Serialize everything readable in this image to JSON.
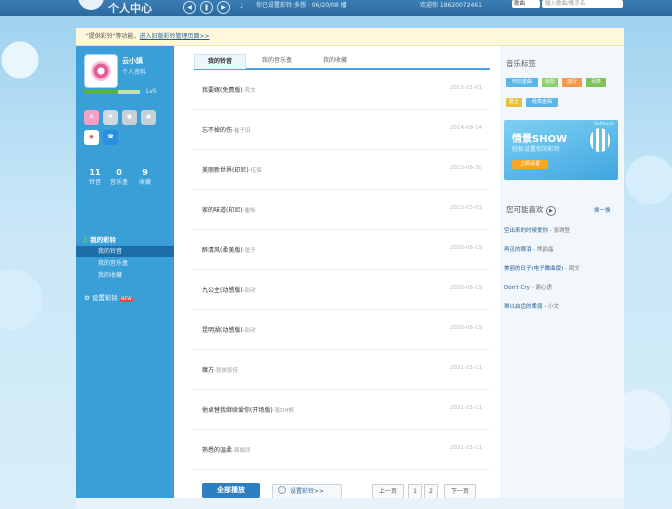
{
  "topbar": {
    "logo_text": "个人中心",
    "now_playing": "你已设置彩铃:多想 · 06/20/08 播",
    "user": "欢迎你 18620072461",
    "search_select": "歌曲",
    "search_placeholder": "输入歌曲/歌手名"
  },
  "notice": {
    "text": "\"提供彩铃\"等功能，",
    "link": "进入旧版彩铃管理页面>>"
  },
  "sidebar": {
    "user_name": "云小謓",
    "profile_link": "个人资料",
    "level": "Lv5",
    "stats": [
      {
        "num": "11",
        "label": "铃音"
      },
      {
        "num": "0",
        "label": "音乐盒"
      },
      {
        "num": "9",
        "label": "收藏"
      }
    ],
    "menu_header": "我的彩铃",
    "menu_items": [
      "我的铃音",
      "我的音乐盒",
      "我的收藏"
    ],
    "set_ring": "设置彩铃",
    "new_badge": "NEW"
  },
  "tabs": [
    "我的铃音",
    "我的音乐盒",
    "我的收藏"
  ],
  "songs": [
    {
      "title": "我要嫁(免费版)",
      "artist": "-弯文",
      "date": "2015-01-01"
    },
    {
      "title": "忘不掉的伤",
      "artist": "-崔子旧",
      "date": "2014-09-14"
    },
    {
      "title": "美丽新世界(印尼)",
      "artist": "-伍佰",
      "date": "2013-06-30"
    },
    {
      "title": "家的味道(印尼)",
      "artist": "-崔咏",
      "date": "2013-03-03"
    },
    {
      "title": "醉清风(柔美版)",
      "artist": "-弦子",
      "date": "2020-06-19"
    },
    {
      "title": "九公主(动感版)",
      "artist": "-彭欣",
      "date": "2020-06-19"
    },
    {
      "title": "昆明湖(动感版)",
      "artist": "-彭欣",
      "date": "2020-06-19"
    },
    {
      "title": "魔方",
      "artist": "-张侠张佳",
      "date": "2021-01-11"
    },
    {
      "title": "他卓替我继续爱你(开场版)",
      "artist": "-张DH帆",
      "date": "2021-01-11"
    },
    {
      "title": "熟悉的温柔",
      "artist": "-周俊同",
      "date": "2021-01-11"
    }
  ],
  "actions": {
    "play_all": "全部播放",
    "set_ring": "设置彩铃>>",
    "prev": "上一页",
    "page1": "1",
    "page2": "2",
    "next": "下一页"
  },
  "right": {
    "tags_title": "音乐标签",
    "tags": [
      "怀旧金曲",
      "轻松",
      "流行",
      "另类",
      "爵士",
      "经典金曲"
    ],
    "banner_title": "情景SHOW",
    "banner_sub": "轻松设置你的彩铃",
    "banner_btn": "立即设置",
    "banner_brand": "Softbank",
    "like_title": "您可能喜欢",
    "refresh": "换一换",
    "recs": [
      {
        "title": "空出来的时候爱你",
        "artist": "- 张琪登"
      },
      {
        "title": "再见的眼泪",
        "artist": "- 熊韵晶"
      },
      {
        "title": "美丽的日子(电子舞曲版)",
        "artist": "- 周文"
      },
      {
        "title": "Don't Cry",
        "artist": "- 谢心语"
      },
      {
        "title": "难以启齿的柔弱",
        "artist": "- 小文"
      }
    ]
  },
  "colors": {
    "accent": "#3a9fd6",
    "dark": "#1d6ea6",
    "play": "#2d7fc2"
  }
}
